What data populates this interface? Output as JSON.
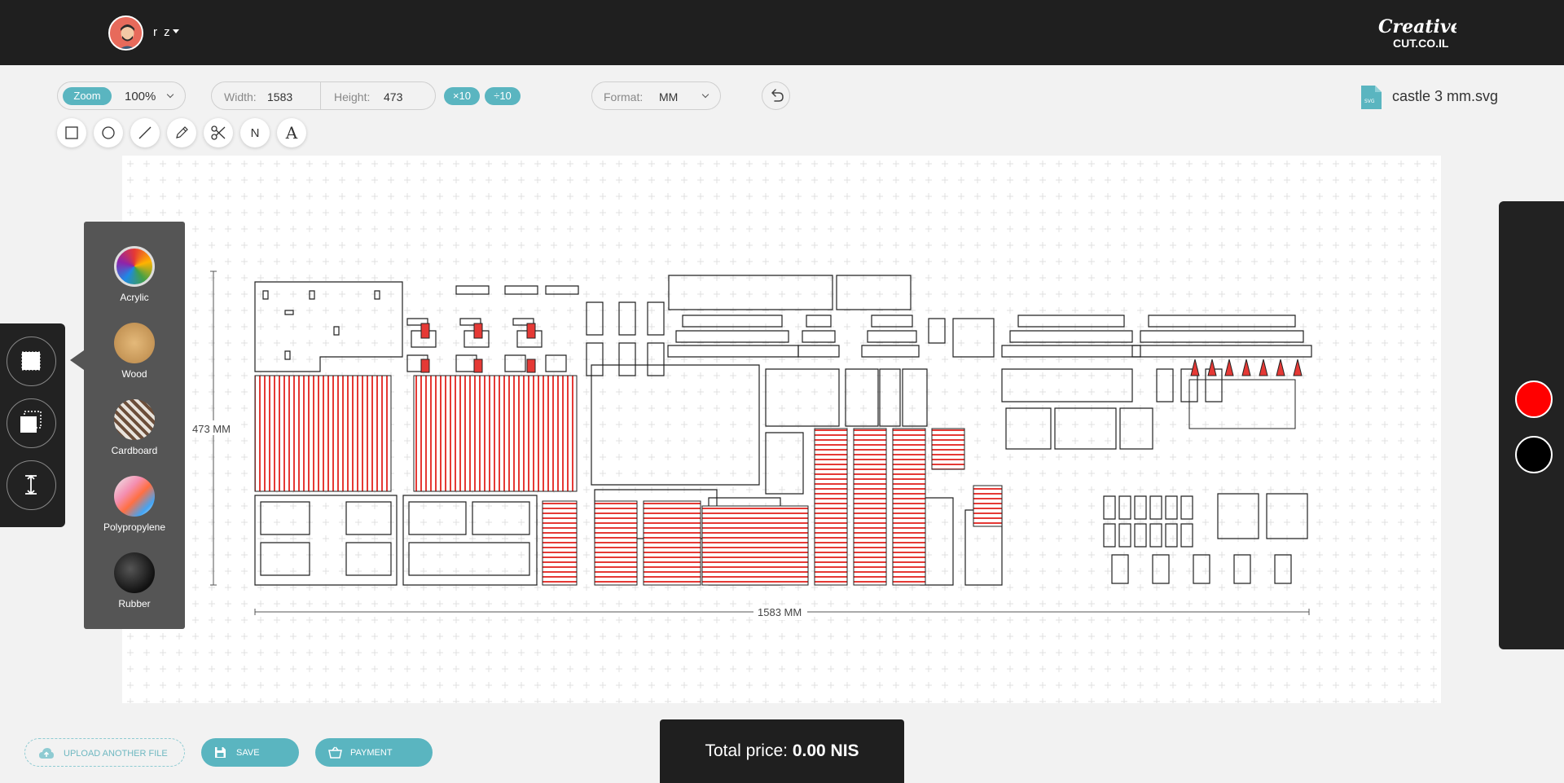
{
  "header": {
    "user_name": "r z",
    "brand": [
      "Creative",
      "CUT.CO.IL"
    ]
  },
  "toolbar": {
    "zoom_label": "Zoom",
    "zoom_value": "100%",
    "width_label": "Width:",
    "width_value": "1583",
    "height_label": "Height:",
    "height_value": "473",
    "mult_buttons": [
      "×10",
      "÷10"
    ],
    "format_label": "Format:",
    "format_value": "MM",
    "file_badge": "SVG",
    "file_name": "castle 3 mm.svg"
  },
  "tools": [
    "rectangle-icon",
    "circle-icon",
    "line-icon",
    "pencil-icon",
    "scissors-icon",
    "N",
    "A"
  ],
  "canvas": {
    "height_dimension": "473 MM",
    "width_dimension": "1583 MM"
  },
  "materials": [
    "Acrylic",
    "Wood",
    "Cardboard",
    "Polypropylene",
    "Rubber"
  ],
  "side_tools": [
    "material-icon",
    "layers-icon",
    "thickness-icon"
  ],
  "colors": {
    "accent": "#5ab5c0",
    "cut_red": "#ff0000",
    "cut_black": "#000000"
  },
  "bottom": {
    "upload_label": "UPLOAD ANOTHER FILE",
    "save_label": "SAVE",
    "payment_label": "PAYMENT",
    "total_label": "Total price:",
    "total_value": "0.00 NIS"
  }
}
